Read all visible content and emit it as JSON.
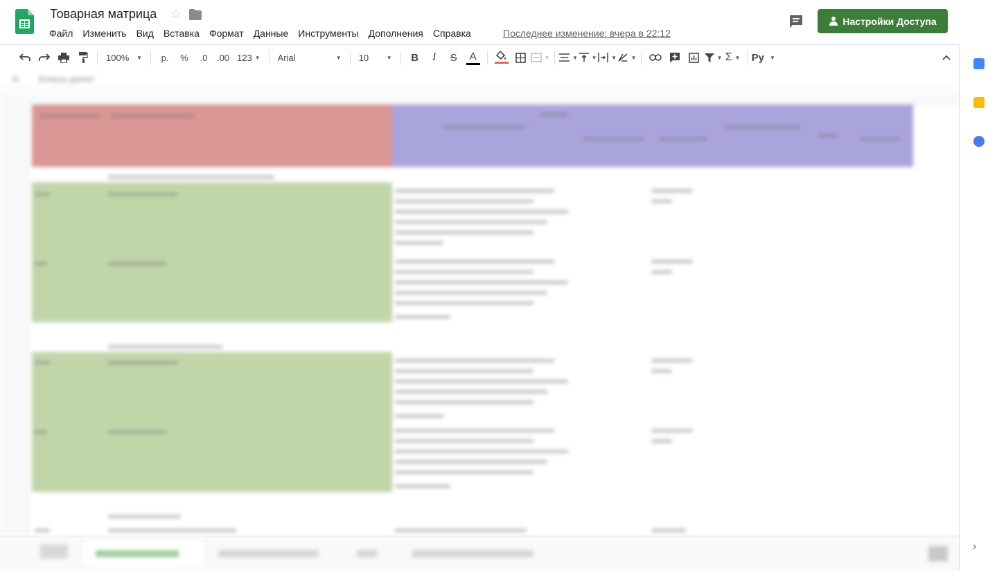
{
  "doc": {
    "title": "Товарная матрица"
  },
  "menu": [
    "Файл",
    "Изменить",
    "Вид",
    "Вставка",
    "Формат",
    "Данные",
    "Инструменты",
    "Дополнения",
    "Справка"
  ],
  "last_edit": "Последнее изменение: вчера в 22:12",
  "share": {
    "label": "Настройки Доступа"
  },
  "toolbar": {
    "zoom": "100%",
    "currency": "р.",
    "percent": "%",
    "decrease_decimal": ".0",
    "increase_decimal": ".00",
    "number_format": "123",
    "font": "Arial",
    "font_size": "10",
    "bold": "B",
    "italic": "I",
    "strike": "S",
    "text_color": "A",
    "functions": "Σ",
    "input_tools": "Ру"
  },
  "formula_bar": {
    "fx": "fx",
    "value": "Бонусы да/нет"
  },
  "colors": {
    "brand_green": "#3d7d3a",
    "header_red": "#d99795",
    "header_purple": "#aaa4dc",
    "row_green": "#c0d6a9"
  }
}
